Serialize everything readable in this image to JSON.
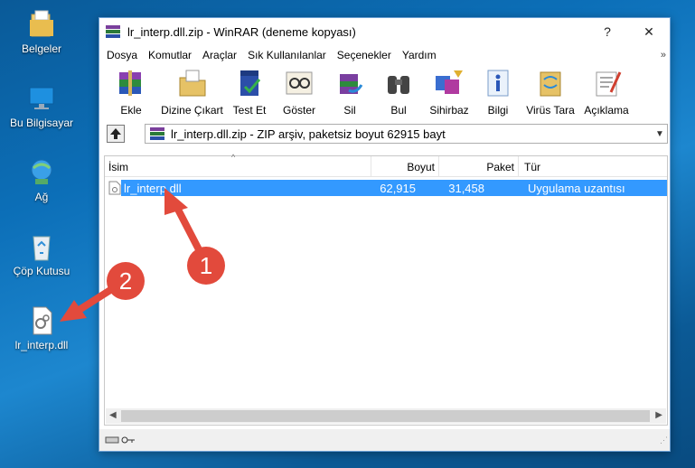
{
  "desktop": {
    "icons": [
      {
        "label": "Belgeler"
      },
      {
        "label": "Bu Bilgisayar"
      },
      {
        "label": "Ağ"
      },
      {
        "label": "Çöp Kutusu"
      },
      {
        "label": "lr_interp.dll"
      }
    ]
  },
  "window": {
    "title": "lr_interp.dll.zip - WinRAR (deneme kopyası)",
    "help_glyph": "?",
    "close_glyph": "✕"
  },
  "menu": [
    "Dosya",
    "Komutlar",
    "Araçlar",
    "Sık Kullanılanlar",
    "Seçenekler",
    "Yardım"
  ],
  "menu_more": "»",
  "toolbar": [
    {
      "label": "Ekle",
      "icon": "add-icon"
    },
    {
      "label": "Dizine Çıkart",
      "icon": "extract-icon"
    },
    {
      "label": "Test Et",
      "icon": "test-icon"
    },
    {
      "label": "Göster",
      "icon": "view-icon"
    },
    {
      "label": "Sil",
      "icon": "delete-icon"
    },
    {
      "label": "Bul",
      "icon": "find-icon"
    },
    {
      "label": "Sihirbaz",
      "icon": "wizard-icon"
    },
    {
      "label": "Bilgi",
      "icon": "info-icon"
    },
    {
      "label": "Virüs Tara",
      "icon": "virus-scan-icon"
    },
    {
      "label": "Açıklama",
      "icon": "comment-icon"
    }
  ],
  "address": {
    "path": "lr_interp.dll.zip - ZIP arşiv, paketsiz boyut 62915 bayt"
  },
  "columns": {
    "name": "İsim",
    "size": "Boyut",
    "packed": "Paket",
    "type": "Tür"
  },
  "files": [
    {
      "name": "lr_interp.dll",
      "size": "62,915",
      "packed": "31,458",
      "type": "Uygulama uzantısı"
    }
  ],
  "annotations": {
    "one": "1",
    "two": "2"
  },
  "colors": {
    "selection": "#3399ff",
    "annotation": "#e24a3c"
  }
}
